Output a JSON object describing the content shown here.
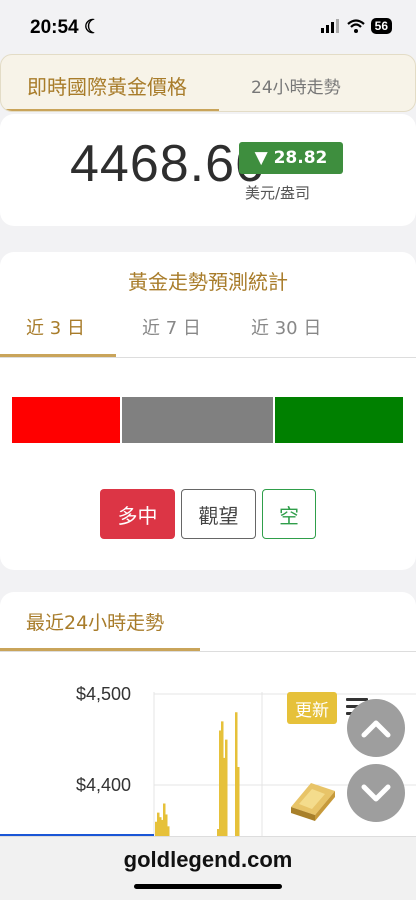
{
  "status_bar": {
    "time": "20:54",
    "battery": "56"
  },
  "tabs": {
    "active": "即時國際黃金價格",
    "inactive": "24小時走勢"
  },
  "price": {
    "value": "4468.66",
    "change": "▼ 28.82",
    "unit": "美元/盎司",
    "change_color": "#3e8e3e"
  },
  "forecast": {
    "title": "黃金走勢預測統計",
    "periods": [
      "近 3 日",
      "近 7 日",
      "近 30 日"
    ],
    "active_period": "近 3 日",
    "distribution": [
      {
        "name": "多",
        "fraction": 0.28,
        "color": "#ff0000"
      },
      {
        "name": "觀望",
        "fraction": 0.39,
        "color": "#808080"
      },
      {
        "name": "空",
        "fraction": 0.33,
        "color": "#008000"
      }
    ],
    "buttons": {
      "long": "多中",
      "wait": "觀望",
      "short": "空"
    }
  },
  "trend": {
    "title": "最近24小時走勢",
    "update_label": "更新",
    "menu_icon": "hamburger-menu-icon"
  },
  "chart_data": {
    "type": "area",
    "y_ticks": [
      "$4,500",
      "$4,400"
    ],
    "ylim": [
      4350,
      4510
    ],
    "series": [
      {
        "values": [
          4370,
          4380,
          4375,
          4372,
          4390,
          4378,
          4365,
          4362,
          4470,
          4480,
          4440,
          4460,
          4490,
          4430
        ]
      }
    ],
    "color": "#e6c13a"
  },
  "bottom": {
    "url": "goldlegend.com"
  }
}
